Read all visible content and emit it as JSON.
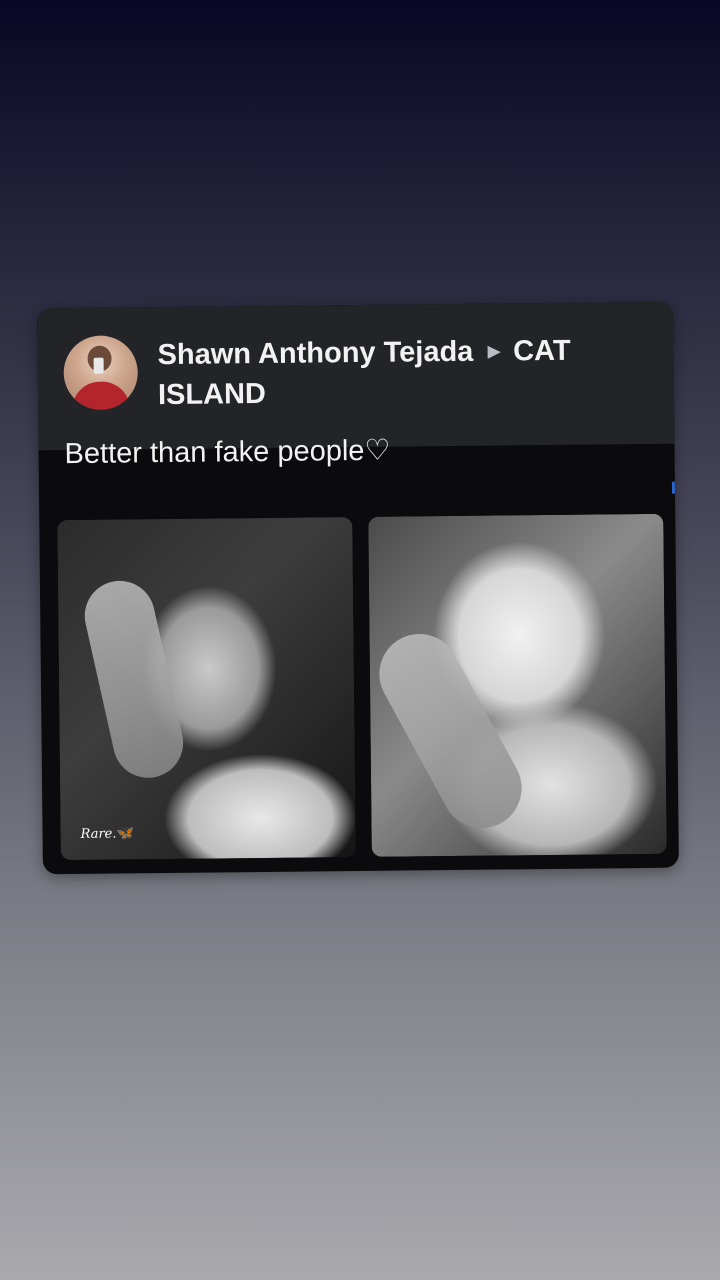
{
  "post": {
    "author_name": "Shawn Anthony Tejada",
    "arrow": "►",
    "group_name": "CAT ISLAND",
    "text": "Better than fake people♡",
    "photos": [
      {
        "subject": "cat",
        "caption": "Rare.",
        "caption_icon": "🦋"
      },
      {
        "subject": "puppy",
        "caption": ""
      }
    ]
  },
  "icons": {
    "avatar": "avatar-photo",
    "arrow": "triangle-right-icon",
    "butterfly": "butterfly-icon"
  },
  "colors": {
    "card_header": "#232427",
    "card_body": "#0b0b0d",
    "text": "#f2f2f2",
    "accent_edge": "#2a63c8"
  }
}
